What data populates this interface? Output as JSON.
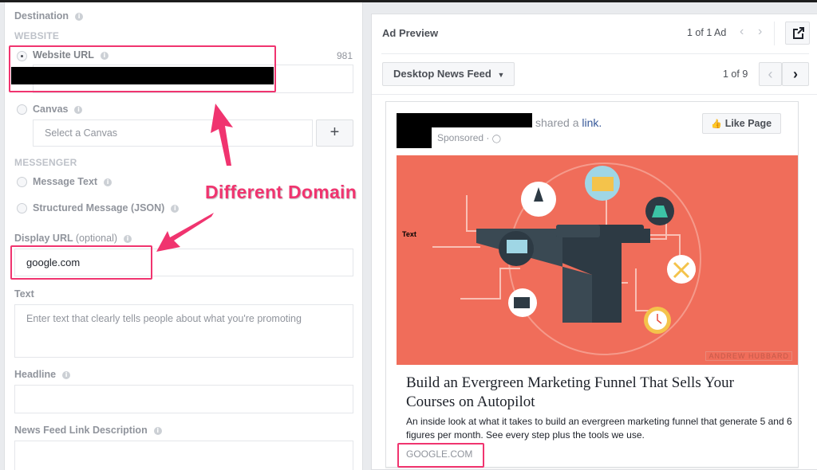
{
  "left_panel": {
    "destination": {
      "label": "Destination"
    },
    "website_section": "WEBSITE",
    "website_url": {
      "label": "Website URL",
      "char_count": "981",
      "value": "",
      "selected": true
    },
    "canvas": {
      "label": "Canvas",
      "placeholder": "Select a Canvas",
      "add_label": "+",
      "selected": false
    },
    "messenger_section": "MESSENGER",
    "message_text": {
      "label": "Message Text",
      "selected": false
    },
    "structured_message": {
      "label": "Structured Message (JSON)",
      "selected": false
    },
    "display_url": {
      "label": "Display URL",
      "optional": "(optional)",
      "value": "google.com"
    },
    "text": {
      "label": "Text",
      "placeholder": "Enter text that clearly tells people about what you're promoting"
    },
    "headline": {
      "label": "Headline",
      "value": ""
    },
    "link_description": {
      "label": "News Feed Link Description",
      "value": ""
    }
  },
  "annotation": {
    "label": "Different Domain",
    "color": "#f0346f"
  },
  "ad_preview": {
    "title": "Ad Preview",
    "ad_counter": "1 of 1 Ad",
    "placement": "Desktop News Feed",
    "placement_counter": "1 of 9",
    "icons": {
      "prev": "chevron-left-icon",
      "next": "chevron-right-icon",
      "external": "external-link-icon",
      "dropdown": "caret-down-icon"
    }
  },
  "post": {
    "shared_text": "shared a",
    "link_word": "link.",
    "sponsored": "Sponsored ·",
    "like_button": "Like Page",
    "image_overlay_text": "Text",
    "image_watermark": "ANDREW HUBBARD",
    "headline": "Build an Evergreen Marketing Funnel That Sells Your Courses on Autopilot",
    "description": "An inside look at what it takes to build an evergreen marketing funnel that generate 5 and 6 figures per month. See every step plus the tools we use.",
    "domain": "GOOGLE.COM",
    "colors": {
      "hero_bg": "#f06d5a",
      "funnel": "#34444f",
      "link": "#365899"
    }
  }
}
